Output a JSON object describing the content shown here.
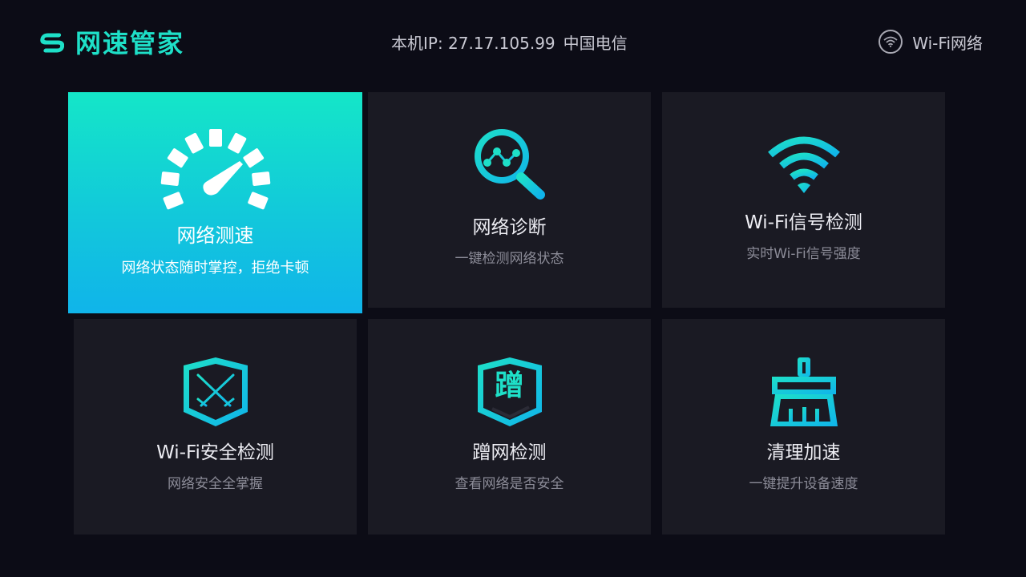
{
  "header": {
    "app_title": "网速管家",
    "ip_label": "本机IP: 27.17.105.99",
    "isp": "中国电信",
    "wifi_label": "Wi-Fi网络"
  },
  "colors": {
    "accent": "#1ee0c8",
    "accent_blue": "#10b4ea",
    "background": "#0c0c16",
    "tile": "#1a1a23"
  },
  "tiles": [
    {
      "icon": "speedometer-icon",
      "title": "网络测速",
      "subtitle": "网络状态随时掌控，拒绝卡顿",
      "selected": true
    },
    {
      "icon": "diagnose-magnifier-icon",
      "title": "网络诊断",
      "subtitle": "一键检测网络状态",
      "selected": false
    },
    {
      "icon": "wifi-signal-icon",
      "title": "Wi-Fi信号检测",
      "subtitle": "实时Wi-Fi信号强度",
      "selected": false
    },
    {
      "icon": "shield-swords-icon",
      "title": "Wi-Fi安全检测",
      "subtitle": "网络安全全掌握",
      "selected": false
    },
    {
      "icon": "freeloader-badge-icon",
      "badge_char": "蹭",
      "title": "蹭网检测",
      "subtitle": "查看网络是否安全",
      "selected": false
    },
    {
      "icon": "broom-icon",
      "title": "清理加速",
      "subtitle": "一键提升设备速度",
      "selected": false
    }
  ]
}
